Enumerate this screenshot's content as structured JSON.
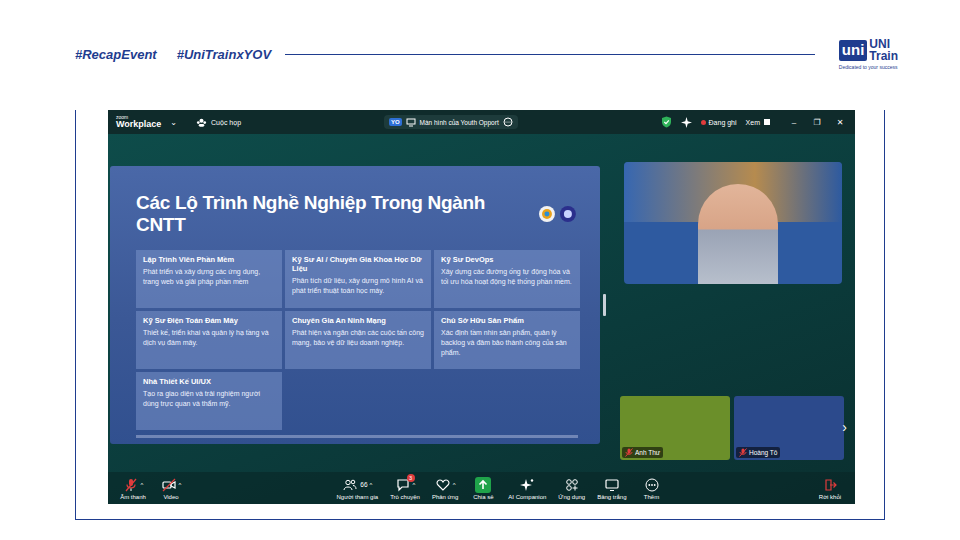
{
  "header": {
    "tags": [
      "#RecapEvent",
      "#UniTrainxYOV"
    ],
    "logo": {
      "mark": "uni",
      "name_top": "UNI",
      "name_bottom": "Train",
      "tagline": "Dedicated to your success"
    }
  },
  "zoom": {
    "titlebar": {
      "brand_top": "zoom",
      "brand_bottom": "Workplace",
      "menu_caret": "⌄",
      "meeting": "Cuộc họp",
      "share_badge": "YO",
      "share_title": "Màn hình của Youth Opport",
      "recording": "Đang ghi",
      "view": "Xem",
      "controls": [
        "–",
        "❐",
        "✕"
      ]
    },
    "slide": {
      "title": "Các Lộ Trình Nghề Nghiệp Trong Ngành CNTT",
      "cards": [
        {
          "title": "Lập Trình Viên Phần Mềm",
          "desc": "Phát triển và xây dựng các ứng dụng, trang web và giải pháp phần mềm"
        },
        {
          "title": "Kỹ Sư AI / Chuyên Gia Khoa Học Dữ Liệu",
          "desc": "Phân tích dữ liệu, xây dựng mô hình AI và phát triển thuật toán học máy."
        },
        {
          "title": "Kỹ Sư DevOps",
          "desc": "Xây dựng các đường ống tự động hóa và tối ưu hóa hoạt động hệ thống phần mềm."
        },
        {
          "title": "Kỹ Sư Điện Toán Đám Mây",
          "desc": "Thiết kế, triển khai và quản lý hạ tầng và dịch vụ đám mây."
        },
        {
          "title": "Chuyên Gia An Ninh Mạng",
          "desc": "Phát hiện và ngăn chặn các cuộc tấn công mạng, bảo vệ dữ liệu doanh nghiệp."
        },
        {
          "title": "Chủ Sở Hữu Sản Phẩm",
          "desc": "Xác định tầm nhìn sản phẩm, quản lý backlog và đảm bảo thành công của sản phẩm."
        },
        {
          "title": "Nhà Thiết Kế UI/UX",
          "desc": "Tạo ra giao diện và trải nghiệm người dùng trực quan và thẩm mỹ."
        }
      ]
    },
    "participants": [
      {
        "name": "Anh Thư",
        "muted": true,
        "color": "#6b8f2a"
      },
      {
        "name": "Hoàng Tô",
        "muted": true,
        "color": "#2c4a8c"
      }
    ],
    "strip_next": "›",
    "toolbar": {
      "left": [
        {
          "kind": "mic",
          "label": "Âm thanh",
          "muted": true,
          "has_menu": true
        },
        {
          "kind": "video",
          "label": "Video",
          "muted": true,
          "has_menu": true
        }
      ],
      "center": [
        {
          "kind": "people",
          "label": "Người tham gia",
          "count": "66",
          "has_menu": true
        },
        {
          "kind": "chat",
          "label": "Trò chuyện",
          "badge": "3",
          "has_menu": true
        },
        {
          "kind": "react",
          "label": "Phản ứng",
          "has_menu": true
        },
        {
          "kind": "share",
          "label": "Chia sẻ",
          "has_menu": false
        },
        {
          "kind": "ai",
          "label": "AI Companion",
          "has_menu": false
        },
        {
          "kind": "apps",
          "label": "Ứng dụng",
          "has_menu": false
        },
        {
          "kind": "board",
          "label": "Bảng trắng",
          "has_menu": false
        },
        {
          "kind": "more",
          "label": "Thêm",
          "has_menu": false
        }
      ],
      "right": [
        {
          "kind": "leave",
          "label": "Rời khỏi",
          "has_menu": false
        }
      ],
      "menu_caret": "^"
    }
  }
}
